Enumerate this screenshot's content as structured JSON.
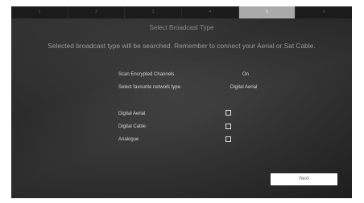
{
  "steps": [
    "1",
    "2",
    "3",
    "4",
    "5",
    "6"
  ],
  "active_step": "5",
  "title": "Select Broadcast Type",
  "subtitle": "Selected broadcast type will be searched. Remember to connect your Aerial or Sat Cable.",
  "settings": [
    {
      "label": "Scan Encrypted Channels",
      "value": "On"
    },
    {
      "label": "Select favourite network type",
      "value": "Digital Aerial"
    }
  ],
  "broadcast_types": [
    {
      "label": "Digital Aerial",
      "checked": false
    },
    {
      "label": "Digital Cable",
      "checked": false
    },
    {
      "label": "Analogue",
      "checked": false
    }
  ],
  "next_label": "Next"
}
